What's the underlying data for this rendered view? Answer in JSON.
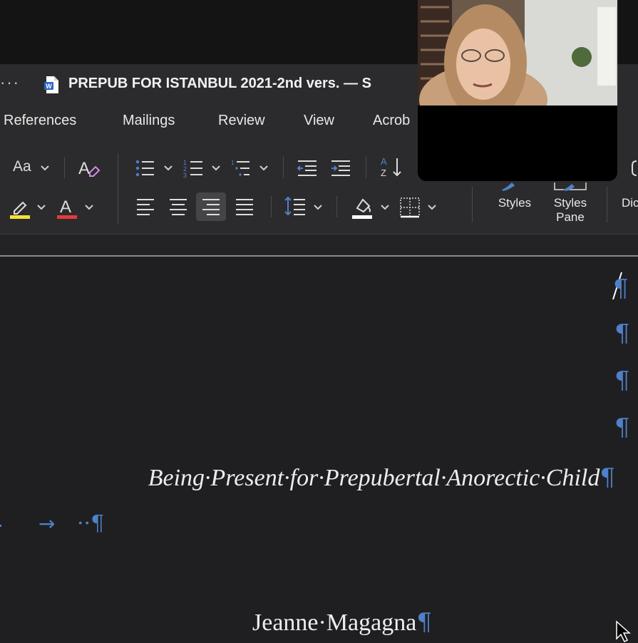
{
  "titlebar": {
    "overflow_label": "···",
    "document_title": "PREPUB FOR  ISTANBUL 2021-2nd vers. — S"
  },
  "tabs": [
    "References",
    "Mailings",
    "Review",
    "View",
    "Acrob"
  ],
  "ribbon": {
    "change_case_label": "Aa",
    "styles_label": "Styles",
    "styles_pane_line1": "Styles",
    "styles_pane_line2": "Pane",
    "dictate_label": "Dic",
    "highlight_color": "#f5e133",
    "font_color": "#e53b3b"
  },
  "document": {
    "title_text": "Being·Present·for·Prepubertal·Anorectic·Child",
    "tab_arrow": "→",
    "tab_dots": "··",
    "author_text": "Jeanne·Magagna",
    "pilcrow": "¶"
  },
  "colors": {
    "accent_blue": "#4f80c9",
    "ribbon_bg": "#2b2b2d",
    "doc_bg": "#1f1f21"
  }
}
